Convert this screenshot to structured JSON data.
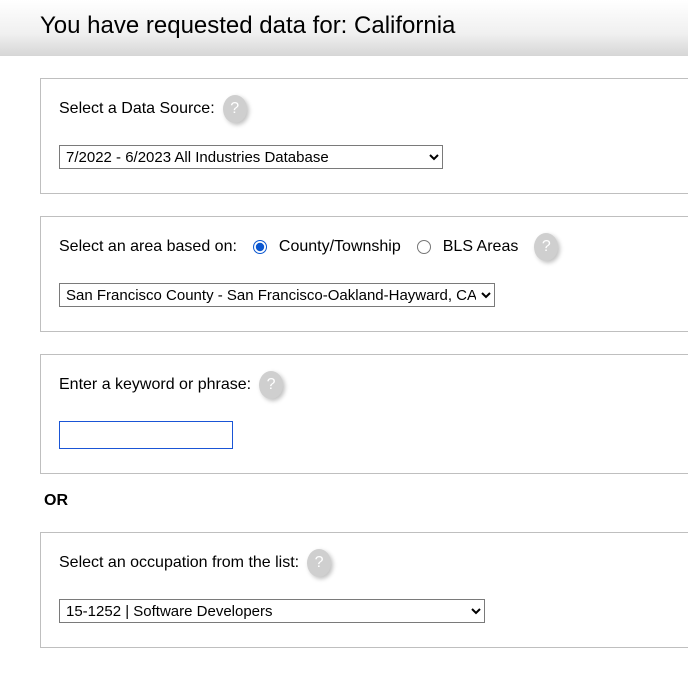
{
  "header": {
    "title": "You have requested data for: California"
  },
  "datasource": {
    "label": "Select a Data Source:",
    "selected": "7/2022 - 6/2023 All Industries Database"
  },
  "area": {
    "label": "Select an area based on:",
    "radio_county_label": "County/Township",
    "radio_bls_label": "BLS Areas",
    "selected_basis": "county",
    "selected": "San Francisco County - San Francisco-Oakland-Hayward, CA"
  },
  "keyword": {
    "label": "Enter a keyword or phrase:",
    "value": ""
  },
  "separator": {
    "or_label": "OR"
  },
  "occupation": {
    "label": "Select an occupation from the list:",
    "selected": "15-1252 | Software Developers"
  },
  "icons": {
    "help": "?"
  }
}
